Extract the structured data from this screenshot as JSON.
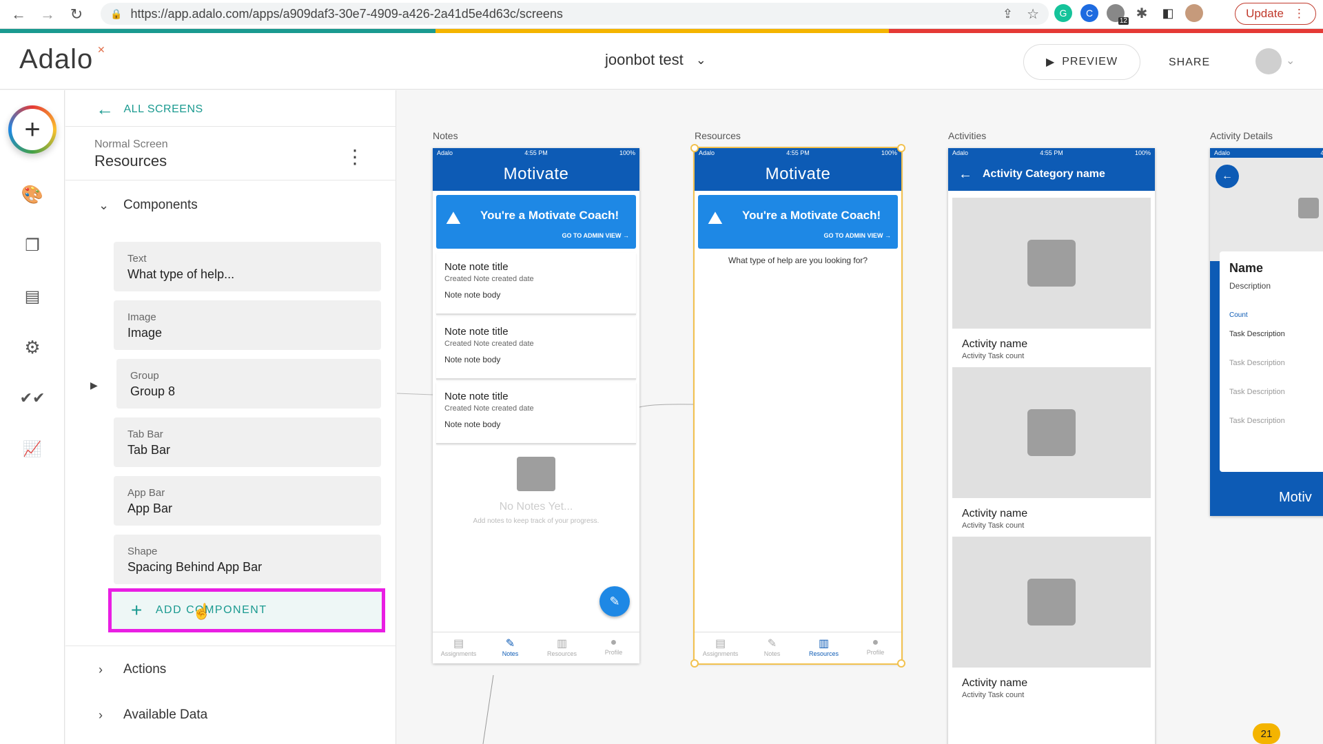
{
  "browser": {
    "url": "https://app.adalo.com/apps/a909daf3-30e7-4909-a426-2a41d5e4d63c/screens",
    "update_label": "Update",
    "ext_badge": "12"
  },
  "header": {
    "logo": "Adalo",
    "project_name": "joonbot test",
    "preview_label": "PREVIEW",
    "share_label": "SHARE"
  },
  "panel": {
    "back_label": "ALL SCREENS",
    "screen_type": "Normal Screen",
    "screen_name": "Resources",
    "components_label": "Components",
    "components": [
      {
        "type": "Text",
        "name": "What type of help..."
      },
      {
        "type": "Image",
        "name": "Image"
      },
      {
        "type": "Group",
        "name": "Group 8"
      },
      {
        "type": "Tab Bar",
        "name": "Tab Bar"
      },
      {
        "type": "App Bar",
        "name": "App Bar"
      },
      {
        "type": "Shape",
        "name": "Spacing Behind App Bar"
      }
    ],
    "add_component_label": "ADD COMPONENT",
    "actions_label": "Actions",
    "available_data_label": "Available Data"
  },
  "canvas": {
    "screens": {
      "notes_label": "Notes",
      "resources_label": "Resources",
      "activities_label": "Activities",
      "activity_details_label": "Activity Details"
    },
    "status": {
      "carrier": "Adalo",
      "time": "4:55 PM",
      "battery": "100%"
    },
    "app_title": "Motivate",
    "coach_title": "You're a Motivate Coach!",
    "coach_sub": "GO TO ADMIN VIEW",
    "notes": [
      {
        "title": "Note note title",
        "date": "Created Note created date",
        "body": "Note note body"
      },
      {
        "title": "Note note title",
        "date": "Created Note created date",
        "body": "Note note body"
      },
      {
        "title": "Note note title",
        "date": "Created Note created date",
        "body": "Note note body"
      }
    ],
    "empty_title": "No Notes Yet...",
    "empty_sub": "Add notes to keep track of your progress.",
    "help_text": "What type of help are you looking for?",
    "tabs": [
      "Assignments",
      "Notes",
      "Resources",
      "Profile"
    ],
    "activity_header": "Activity Category name",
    "activities": [
      {
        "name": "Activity name",
        "count": "Activity Task count"
      },
      {
        "name": "Activity name",
        "count": "Activity Task count"
      },
      {
        "name": "Activity name",
        "count": "Activity Task count"
      }
    ],
    "detail": {
      "name": "Name",
      "description": "Description",
      "count": "Count",
      "tasks": [
        "Task Description",
        "Task Description",
        "Task Description",
        "Task Description"
      ],
      "logo": "Motiv"
    }
  },
  "notification_count": "21"
}
